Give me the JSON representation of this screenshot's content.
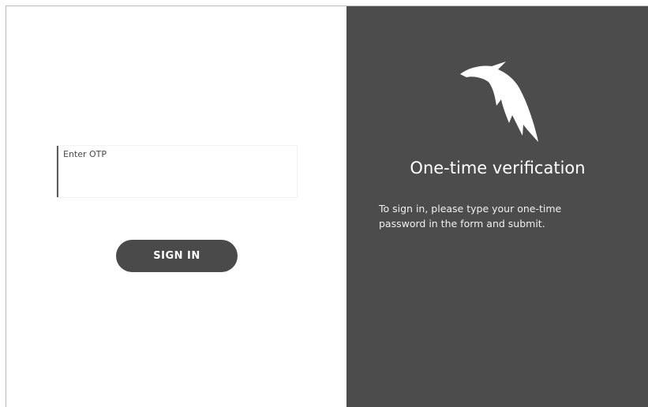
{
  "form": {
    "otp_label": "Enter OTP",
    "otp_value": "",
    "submit_label": "SIGN IN"
  },
  "panel": {
    "title": "One-time verification",
    "description": "To sign in, please type your one-time password in the form and submit.",
    "logo_icon": "eagle-icon",
    "background_color": "#4c4c4c"
  }
}
